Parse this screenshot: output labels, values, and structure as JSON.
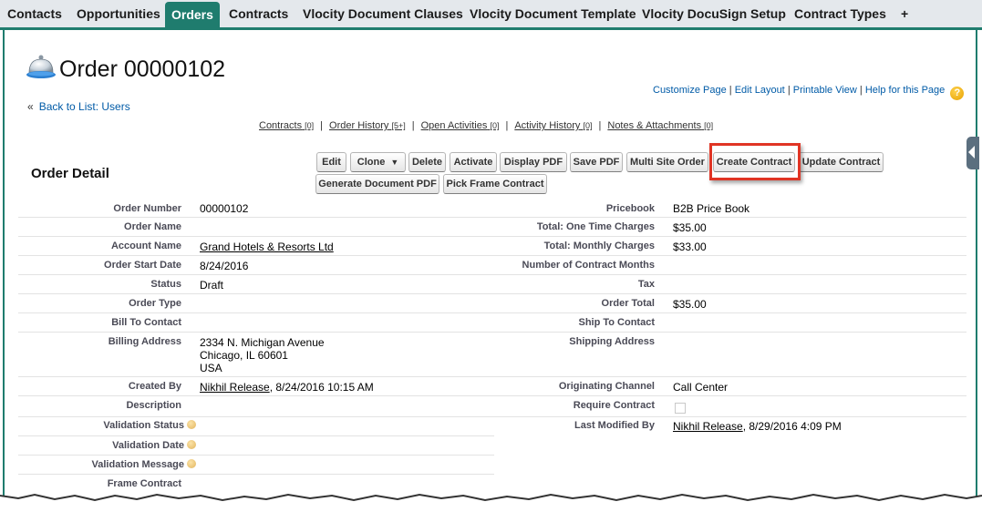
{
  "tabs": [
    {
      "label": "Contacts"
    },
    {
      "label": "Opportunities"
    },
    {
      "label": "Orders"
    },
    {
      "label": "Contracts"
    },
    {
      "label": "Vlocity Document Clauses"
    },
    {
      "label": "Vlocity Document Template"
    },
    {
      "label": "Vlocity DocuSign Setup"
    },
    {
      "label": "Contract Types"
    },
    {
      "label": "+"
    }
  ],
  "header": {
    "title": "Order 00000102",
    "back_link": "Back to List: Users",
    "back_prefix": "«",
    "top_links": {
      "customize": "Customize Page",
      "edit_layout": "Edit Layout",
      "printable": "Printable View",
      "help": "Help for this Page",
      "separator": "|",
      "help_icon": "?"
    }
  },
  "related_links": [
    {
      "label": "Contracts",
      "count": "[0]"
    },
    {
      "label": "Order History",
      "count": "[5+]"
    },
    {
      "label": "Open Activities",
      "count": "[0]"
    },
    {
      "label": "Activity History",
      "count": "[0]"
    },
    {
      "label": "Notes & Attachments",
      "count": "[0]"
    }
  ],
  "detail": {
    "section_title": "Order Detail",
    "buttons": {
      "edit": "Edit",
      "clone": "Clone",
      "clone_caret": "▼",
      "delete": "Delete",
      "activate": "Activate",
      "display_pdf": "Display PDF",
      "save_pdf": "Save PDF",
      "multi_site": "Multi Site Order",
      "create_contract": "Create Contract",
      "update_contract": "Update Contract",
      "generate_doc_pdf": "Generate Document PDF",
      "pick_frame": "Pick Frame Contract"
    },
    "left": {
      "order_number": {
        "label": "Order Number",
        "value": "00000102"
      },
      "order_name": {
        "label": "Order Name",
        "value": ""
      },
      "account_name": {
        "label": "Account Name",
        "value": "Grand Hotels & Resorts Ltd"
      },
      "order_start_date": {
        "label": "Order Start Date",
        "value": "8/24/2016"
      },
      "status": {
        "label": "Status",
        "value": "Draft"
      },
      "order_type": {
        "label": "Order Type",
        "value": ""
      },
      "bill_to_contact": {
        "label": "Bill To Contact",
        "value": ""
      },
      "billing_address": {
        "label": "Billing Address",
        "line1": "2334 N. Michigan Avenue",
        "line2": "Chicago, IL 60601",
        "line3": "USA"
      },
      "created_by": {
        "label": "Created By",
        "user": "Nikhil Release",
        "date": ", 8/24/2016 10:15 AM"
      },
      "description": {
        "label": "Description",
        "value": ""
      },
      "validation_status": {
        "label": "Validation Status",
        "value": ""
      },
      "validation_date": {
        "label": "Validation Date",
        "value": ""
      },
      "validation_message": {
        "label": "Validation Message",
        "value": ""
      },
      "frame_contract": {
        "label": "Frame Contract",
        "value": ""
      }
    },
    "right": {
      "pricebook": {
        "label": "Pricebook",
        "value": "B2B Price Book"
      },
      "one_time": {
        "label": "Total: One Time Charges",
        "value": "$35.00"
      },
      "monthly": {
        "label": "Total: Monthly Charges",
        "value": "$33.00"
      },
      "contract_months": {
        "label": "Number of Contract Months",
        "value": ""
      },
      "tax": {
        "label": "Tax",
        "value": ""
      },
      "order_total": {
        "label": "Order Total",
        "value": "$35.00"
      },
      "ship_to_contact": {
        "label": "Ship To Contact",
        "value": ""
      },
      "shipping_address": {
        "label": "Shipping Address",
        "value": ""
      },
      "originating_channel": {
        "label": "Originating Channel",
        "value": "Call Center"
      },
      "require_contract": {
        "label": "Require Contract",
        "checked": false
      },
      "last_modified_by": {
        "label": "Last Modified By",
        "user": "Nikhil Release",
        "date": ", 8/29/2016 4:09 PM"
      }
    }
  },
  "colors": {
    "tab_active": "#1f7c6e",
    "highlight": "#e03424",
    "link": "#015ba7"
  },
  "icons": {
    "page_icon": "service-bell-icon",
    "help_icon": "help-icon",
    "info_icon": "info-icon",
    "side_tab": "collapse-arrow-icon"
  }
}
